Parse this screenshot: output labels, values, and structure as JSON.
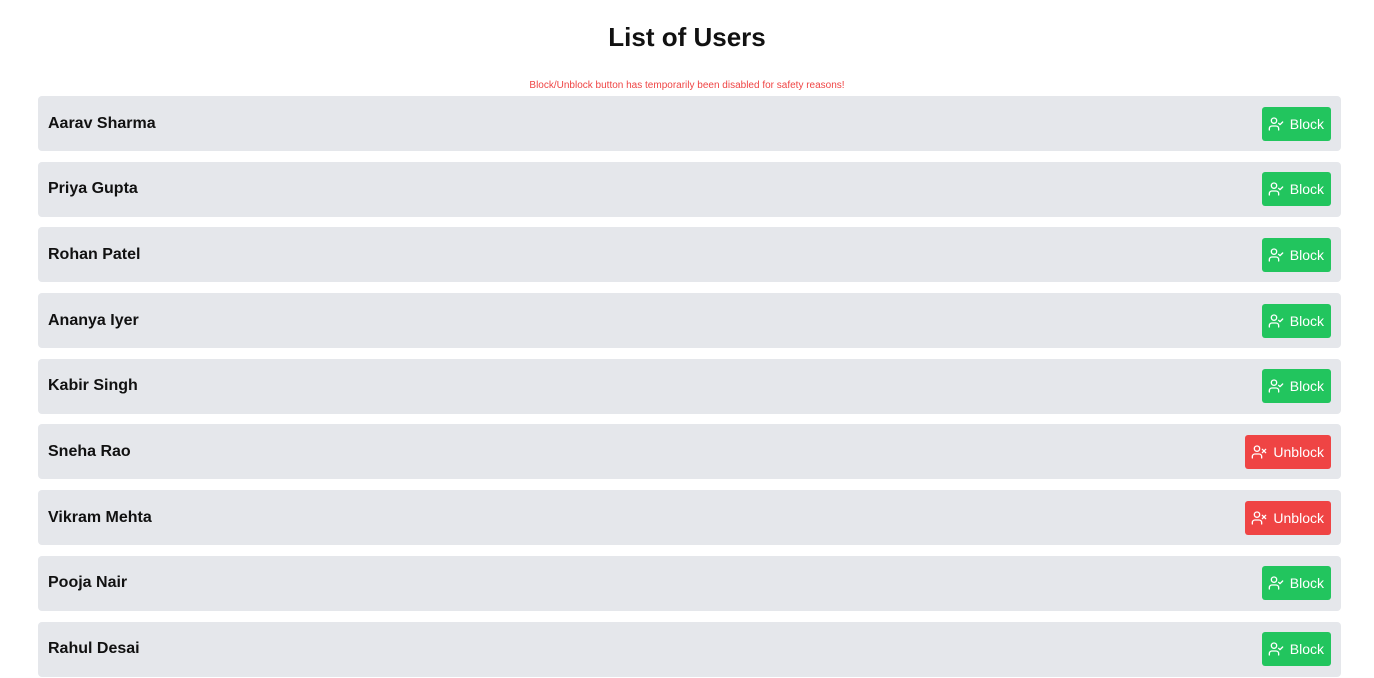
{
  "page": {
    "title": "List of Users",
    "notice": "Block/Unblock button has temporarily been disabled for safety reasons!"
  },
  "colors": {
    "block": "#22c55e",
    "unblock": "#ef4444",
    "row_background": "#e5e7eb",
    "notice": "#ef4444"
  },
  "users": [
    {
      "name": "Aarav Sharma",
      "action": "Block",
      "icon": "user-check-icon",
      "state": "block"
    },
    {
      "name": "Priya Gupta",
      "action": "Block",
      "icon": "user-check-icon",
      "state": "block"
    },
    {
      "name": "Rohan Patel",
      "action": "Block",
      "icon": "user-check-icon",
      "state": "block"
    },
    {
      "name": "Ananya Iyer",
      "action": "Block",
      "icon": "user-check-icon",
      "state": "block"
    },
    {
      "name": "Kabir Singh",
      "action": "Block",
      "icon": "user-check-icon",
      "state": "block"
    },
    {
      "name": "Sneha Rao",
      "action": "Unblock",
      "icon": "user-x-icon",
      "state": "unblock"
    },
    {
      "name": "Vikram Mehta",
      "action": "Unblock",
      "icon": "user-x-icon",
      "state": "unblock"
    },
    {
      "name": "Pooja Nair",
      "action": "Block",
      "icon": "user-check-icon",
      "state": "block"
    },
    {
      "name": "Rahul Desai",
      "action": "Block",
      "icon": "user-check-icon",
      "state": "block"
    }
  ]
}
